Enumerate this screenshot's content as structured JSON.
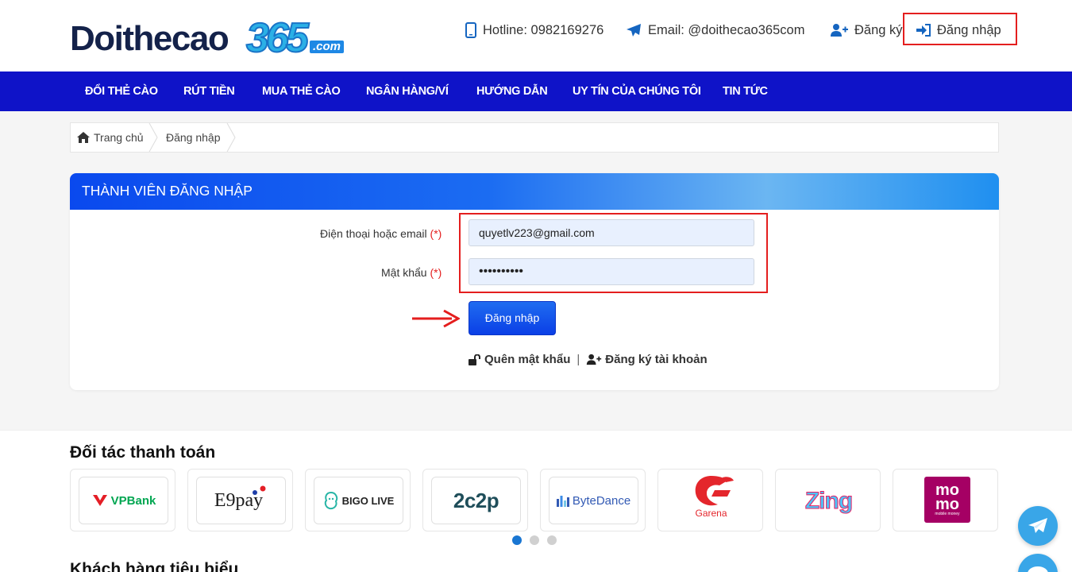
{
  "header": {
    "logo": {
      "part1": "Doithecao",
      "part2": "365",
      "part3": ".com"
    },
    "hotline": "Hotline: 0982169276",
    "email": "Email: @doithecao365com",
    "register": "Đăng ký",
    "login": "Đăng nhập"
  },
  "nav": {
    "items": [
      "ĐỔI THẺ CÀO",
      "RÚT TIỀN",
      "MUA THẺ CÀO",
      "NGÂN HÀNG/VÍ",
      "HƯỚNG DẪN",
      "UY TÍN CỦA CHÚNG TÔI",
      "TIN TỨC"
    ]
  },
  "breadcrumb": {
    "home": "Trang chủ",
    "current": "Đăng nhập"
  },
  "login_form": {
    "title": "THÀNH VIÊN ĐĂNG NHẬP",
    "identity_label": "Điện thoại hoặc email",
    "required_mark": "(*)",
    "identity_value": "quyetlv223@gmail.com",
    "password_label": "Mật khẩu",
    "password_value": "••••••••••",
    "submit_label": "Đăng nhập",
    "forgot_label": "Quên mật khẩu",
    "separator": "|",
    "register_label": "Đăng ký tài khoản"
  },
  "partners": {
    "title": "Đối tác thanh toán",
    "items": [
      {
        "name": "VPBank",
        "color": "#00a651",
        "accent": "#e41e26"
      },
      {
        "name": "E9pay",
        "color": "#1a1a1a"
      },
      {
        "name": "BIGO LIVE",
        "color": "#222222"
      },
      {
        "name": "2c2p",
        "color": "#1f4e5a"
      },
      {
        "name": "ByteDance",
        "color": "#325ab4"
      },
      {
        "name": "Garena",
        "color": "#e4262c"
      },
      {
        "name": "Zing",
        "color": "#4fc3f7"
      },
      {
        "name": "momo",
        "sub": "mobile money",
        "color": "#a50064"
      }
    ],
    "dots": 3,
    "active_dot": 0
  },
  "customers": {
    "title": "Khách hàng tiêu biểu"
  },
  "colors": {
    "nav": "#0f13c8",
    "accent": "#1e5bf0",
    "highlight": "#e41e1e"
  }
}
